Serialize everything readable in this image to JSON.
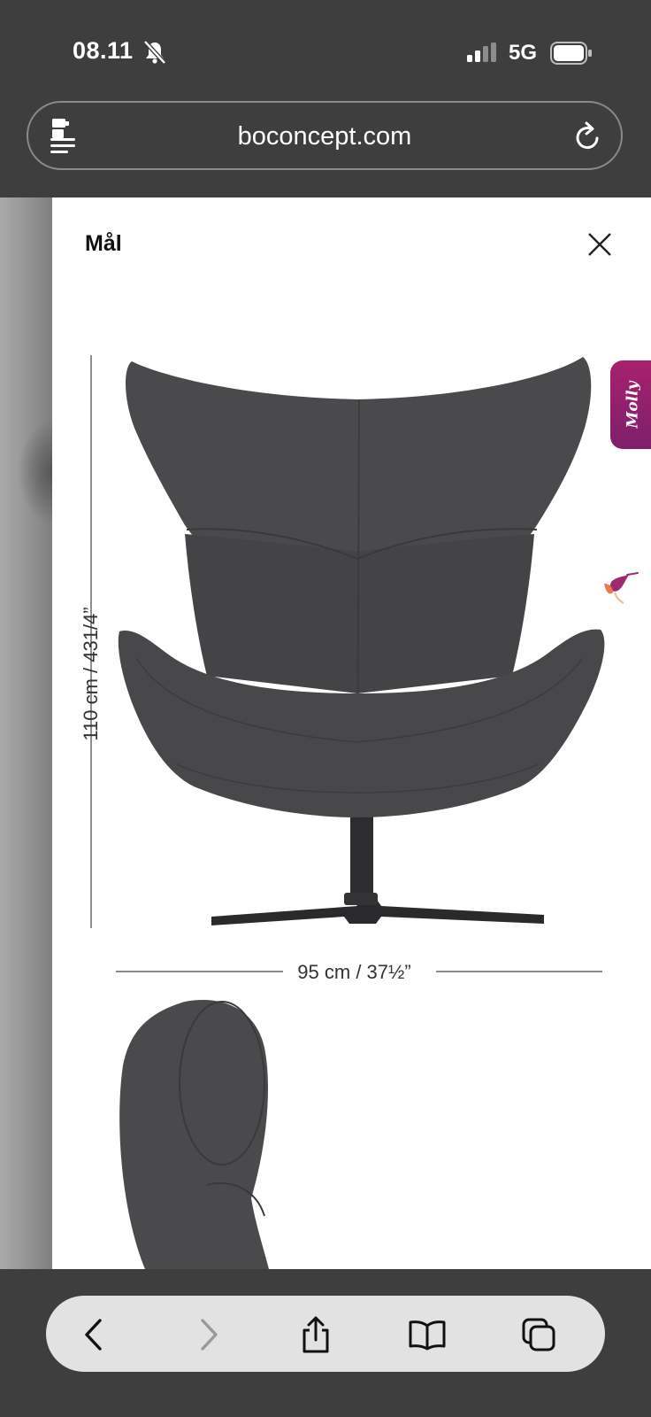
{
  "status_bar": {
    "time": "08.11",
    "network": "5G",
    "icons": [
      "bell-slash-icon",
      "signal-icon",
      "battery-icon"
    ]
  },
  "browser": {
    "url": "boconcept.com",
    "icons": [
      "reader-mode-icon",
      "reload-icon"
    ]
  },
  "sheet": {
    "title": "Mål",
    "height_label": "110 cm / 431/4”",
    "width_label": "95 cm / 37½”",
    "chat_tab_label": "Molly",
    "icons": [
      "close-icon",
      "hummingbird-icon"
    ]
  },
  "toolbar": {
    "icons": [
      "back-icon",
      "forward-icon",
      "share-icon",
      "bookmarks-icon",
      "tabs-icon"
    ]
  },
  "colors": {
    "chrome": "#3e3e3e",
    "chair": "#4a4a4c",
    "molly_tab": "#a8216e"
  }
}
